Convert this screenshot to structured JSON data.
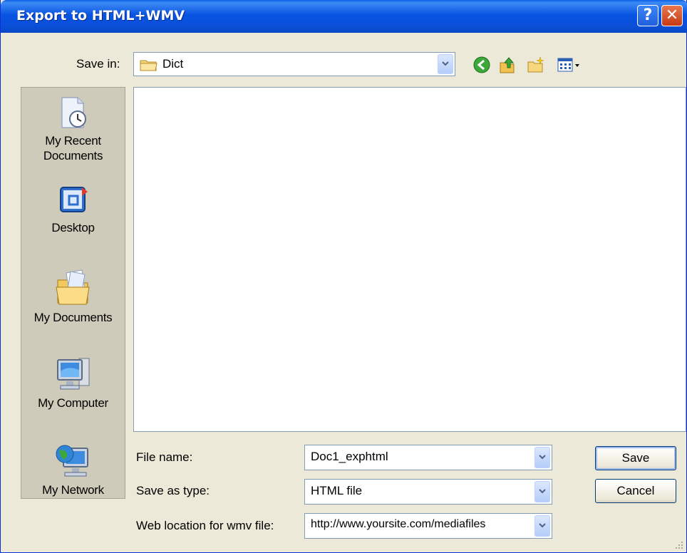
{
  "window": {
    "title": "Export to HTML+WMV"
  },
  "title_buttons": {
    "help": "?",
    "close": "✕"
  },
  "save_in": {
    "label": "Save in:",
    "value": "Dict",
    "icon": "folder-icon"
  },
  "toolbar": {
    "icons": [
      "back-icon",
      "up-folder-icon",
      "new-folder-icon",
      "views-menu-icon"
    ]
  },
  "places": [
    {
      "label_line1": "My Recent",
      "label_line2": "Documents",
      "icon": "recent-documents-icon"
    },
    {
      "label_line1": "Desktop",
      "label_line2": "",
      "icon": "desktop-icon"
    },
    {
      "label_line1": "My Documents",
      "label_line2": "",
      "icon": "my-documents-icon"
    },
    {
      "label_line1": "My Computer",
      "label_line2": "",
      "icon": "my-computer-icon"
    },
    {
      "label_line1": "My Network",
      "label_line2": "",
      "icon": "my-network-icon"
    }
  ],
  "form": {
    "file_name_label": "File name:",
    "file_name_value": "Doc1_exphtml",
    "save_as_type_label": "Save as type:",
    "save_as_type_value": "HTML file",
    "web_location_label": "Web location for wmv file:",
    "web_location_value": "http://www.yoursite.com/mediafiles"
  },
  "buttons": {
    "save": "Save",
    "cancel": "Cancel"
  }
}
